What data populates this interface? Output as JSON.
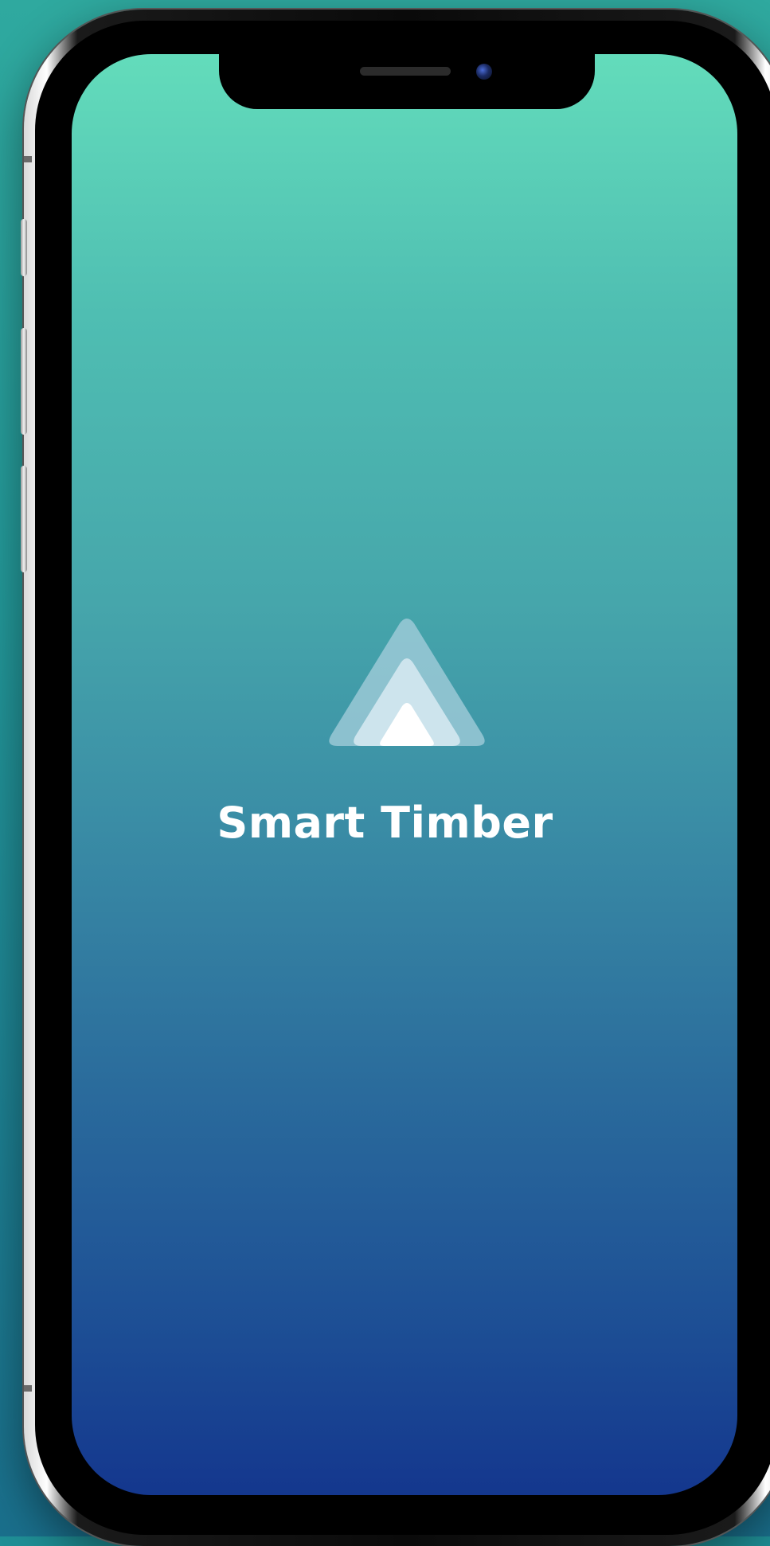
{
  "app": {
    "name": "Smart Timber"
  },
  "splash": {
    "logo_icon": "layered-triangle-logo",
    "gradient_top": "#63dcbb",
    "gradient_bottom": "#14378e",
    "text_color": "#ffffff"
  }
}
